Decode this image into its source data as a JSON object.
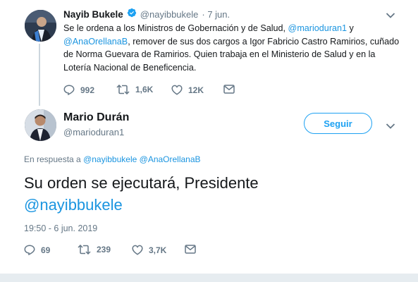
{
  "original_tweet": {
    "author_name": "Nayib Bukele",
    "author_handle": "@nayibbukele",
    "date": "· 7 jun.",
    "text_parts": {
      "p1": "Se le ordena a los Ministros de Gobernación y de Salud, ",
      "mention1": "@marioduran1",
      "p2": " y ",
      "mention2": "@AnaOrellanaB",
      "p3": ", remover de sus dos cargos a Igor Fabricio Castro Ramirios, cuñado de Norma Guevara de Ramirios. Quien trabaja en el Ministerio de Salud y en la Lotería Nacional de Beneficencia."
    },
    "actions": {
      "replies": "992",
      "retweets": "1,6K",
      "likes": "12K"
    }
  },
  "reply_tweet": {
    "author_name": "Mario Durán",
    "author_handle": "@marioduran1",
    "follow_label": "Seguir",
    "in_reply_prefix": "En respuesta a",
    "in_reply_users": [
      "@nayibbukele",
      "@AnaOrellanaB"
    ],
    "text": "Su orden se ejecutará, Presidente",
    "text_mention": "@nayibbukele",
    "timestamp": "19:50 - 6 jun. 2019",
    "actions": {
      "replies": "69",
      "retweets": "239",
      "likes": "3,7K"
    }
  },
  "colors": {
    "link": "#1b95e0",
    "verified": "#1da1f2",
    "muted": "#657786",
    "divider": "#e6ecf0"
  },
  "icons": [
    "verified-icon",
    "reply-icon",
    "retweet-icon",
    "like-icon",
    "dm-icon",
    "chevron-down-icon"
  ]
}
